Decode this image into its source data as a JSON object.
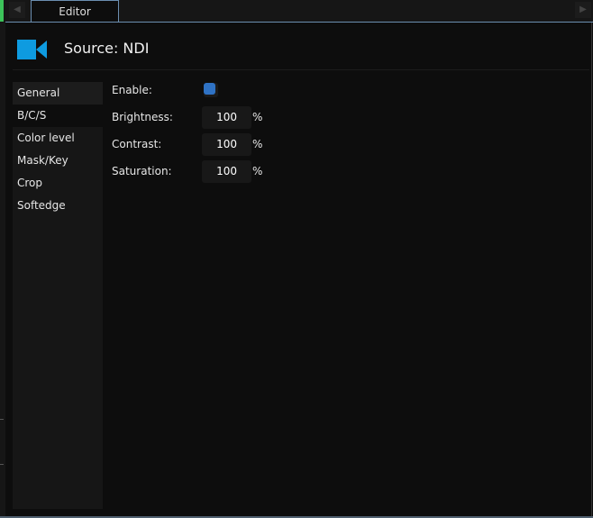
{
  "tabs": {
    "active": "Editor"
  },
  "header": {
    "title": "Source: NDI",
    "icon": "video-camera-icon",
    "icon_color": "#0e9be0"
  },
  "nav": {
    "items": [
      "General",
      "B/C/S",
      "Color level",
      "Mask/Key",
      "Crop",
      "Softedge"
    ],
    "selected": "B/C/S"
  },
  "settings": {
    "enable_label": "Enable:",
    "enable_checked": true,
    "brightness_label": "Brightness:",
    "brightness_value": "100",
    "brightness_unit": "%",
    "contrast_label": "Contrast:",
    "contrast_value": "100",
    "contrast_unit": "%",
    "saturation_label": "Saturation:",
    "saturation_value": "100",
    "saturation_unit": "%"
  }
}
